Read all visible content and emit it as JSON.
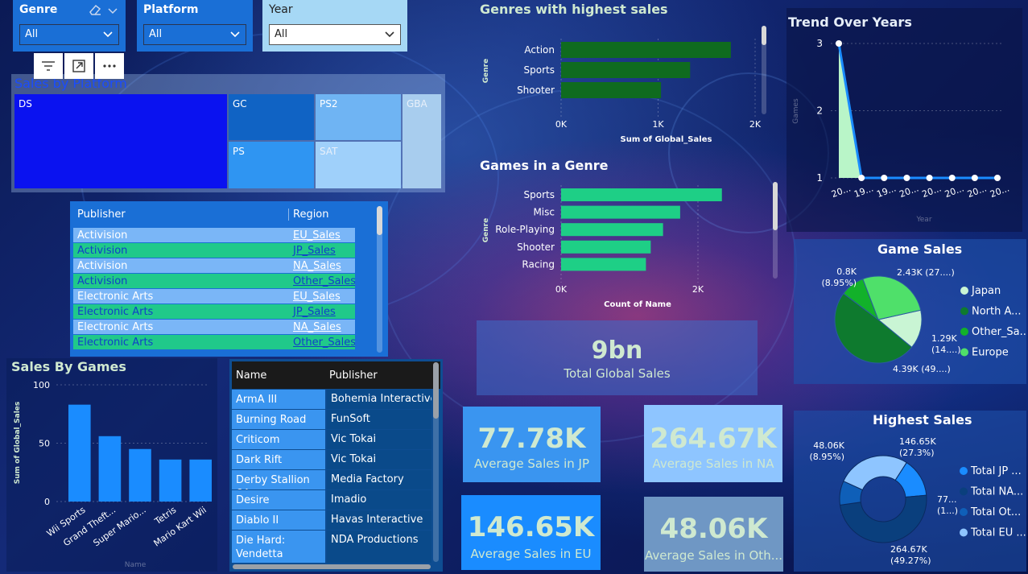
{
  "slicers": {
    "genre": {
      "title": "Genre",
      "value": "All"
    },
    "platform": {
      "title": "Platform",
      "value": "All"
    },
    "year": {
      "title": "Year",
      "value": "All"
    }
  },
  "sales_by_platform": {
    "title": "Sales by Platform",
    "tiles": [
      "DS",
      "GC",
      "PS2",
      "GBA",
      "PS",
      "SAT"
    ]
  },
  "publisher_table": {
    "headers": [
      "Publisher",
      "Region"
    ],
    "rows": [
      [
        "Activision",
        "EU_Sales"
      ],
      [
        "Activision",
        "JP_Sales"
      ],
      [
        "Activision",
        "NA_Sales"
      ],
      [
        "Activision",
        "Other_Sales"
      ],
      [
        "Electronic Arts",
        "EU_Sales"
      ],
      [
        "Electronic Arts",
        "JP_Sales"
      ],
      [
        "Electronic Arts",
        "NA_Sales"
      ],
      [
        "Electronic Arts",
        "Other_Sales"
      ]
    ]
  },
  "name_table": {
    "headers": [
      "Name",
      "Publisher"
    ],
    "rows": [
      [
        "ArmA III",
        "Bohemia Interactive"
      ],
      [
        "Burning Road",
        "FunSoft"
      ],
      [
        "Criticom",
        "Vic Tokai"
      ],
      [
        "Dark Rift",
        "Vic Tokai"
      ],
      [
        "Derby Stallion 64",
        "Media Factory"
      ],
      [
        "Desire",
        "Imadio"
      ],
      [
        "Diablo II",
        "Havas Interactive"
      ],
      [
        "Die Hard:",
        "NDA Productions"
      ]
    ],
    "wrap_line": "Vendetta"
  },
  "kpis": {
    "total": {
      "value": "9bn",
      "label": "Total Global Sales"
    },
    "jp": {
      "value": "77.78K",
      "label": "Average Sales in JP"
    },
    "na": {
      "value": "264.67K",
      "label": "Average Sales in NA"
    },
    "eu": {
      "value": "146.65K",
      "label": "Average Sales in EU"
    },
    "other": {
      "value": "48.06K",
      "label": "Average Sales in Oth..."
    }
  },
  "chart_data": [
    {
      "id": "genres_highest_sales",
      "type": "bar",
      "orientation": "horizontal",
      "title": "Genres with highest sales",
      "categories": [
        "Action",
        "Sports",
        "Shooter"
      ],
      "values": [
        1750,
        1330,
        1030
      ],
      "xlabel": "Sum of Global_Sales",
      "ylabel": "Genre",
      "xlim": [
        0,
        2000
      ],
      "xticks": [
        "0K",
        "1K",
        "2K"
      ],
      "color": "#0f6b1f"
    },
    {
      "id": "games_in_genre",
      "type": "bar",
      "orientation": "horizontal",
      "title": "Games in a Genre",
      "categories": [
        "Sports",
        "Misc",
        "Role-Playing",
        "Shooter",
        "Racing"
      ],
      "values": [
        2350,
        1740,
        1490,
        1310,
        1240
      ],
      "xlabel": "Count of Name",
      "ylabel": "Genre",
      "xlim": [
        0,
        2000
      ],
      "xticks": [
        "0K",
        "2K"
      ],
      "color": "#1ecf86"
    },
    {
      "id": "trend_over_years",
      "type": "area",
      "title": "Trend Over Years",
      "x": [
        "20...",
        "19...",
        "19...",
        "20...",
        "20...",
        "20...",
        "20...",
        "20..."
      ],
      "values": [
        3,
        1,
        1,
        1,
        1,
        1,
        1,
        1
      ],
      "xlabel": "Year",
      "ylabel": "Games",
      "ylim": [
        1,
        3
      ],
      "yticks": [
        "1",
        "2",
        "3"
      ]
    },
    {
      "id": "game_sales",
      "type": "pie",
      "title": "Game Sales",
      "categories": [
        "Japan",
        "North A...",
        "Other_Sa...",
        "Europe"
      ],
      "values": [
        1.29,
        4.39,
        0.8,
        2.43
      ],
      "labels": [
        [
          "1.29K",
          "(14....)"
        ],
        [
          "4.39K (49....)"
        ],
        [
          "0.8K",
          "(8.95%)"
        ],
        [
          "2.43K (27....)"
        ]
      ],
      "colors": [
        "#c9f5d4",
        "#0e7a2e",
        "#12b12a",
        "#4fe06a"
      ],
      "legend": "right"
    },
    {
      "id": "highest_sales",
      "type": "pie",
      "variant": "donut",
      "title": "Highest Sales",
      "categories": [
        "Total JP ...",
        "Total NA...",
        "Total Ot...",
        "Total EU ..."
      ],
      "values": [
        77.78,
        264.67,
        48.06,
        146.65
      ],
      "labels": [
        [
          "77...",
          "(1...)"
        ],
        [
          "264.67K",
          "(49.27%)"
        ],
        [
          "48.06K",
          "(8.95%)"
        ],
        [
          "146.65K",
          "(27.3%)"
        ]
      ],
      "colors": [
        "#1a8cff",
        "#0a3f7d",
        "#0f5fb8",
        "#8ec5ff"
      ],
      "legend": "right"
    },
    {
      "id": "sales_by_games",
      "type": "bar",
      "title": "Sales By Games",
      "categories": [
        "Wii Sports",
        "Grand Theft...",
        "Super Mario...",
        "Tetris",
        "Mario Kart Wii"
      ],
      "values": [
        83,
        56,
        45,
        36,
        36
      ],
      "xlabel": "Name",
      "ylabel": "Sum of Global_Sales",
      "ylim": [
        0,
        100
      ],
      "yticks": [
        "0",
        "50",
        "100"
      ],
      "color": "#1a8cff"
    }
  ]
}
